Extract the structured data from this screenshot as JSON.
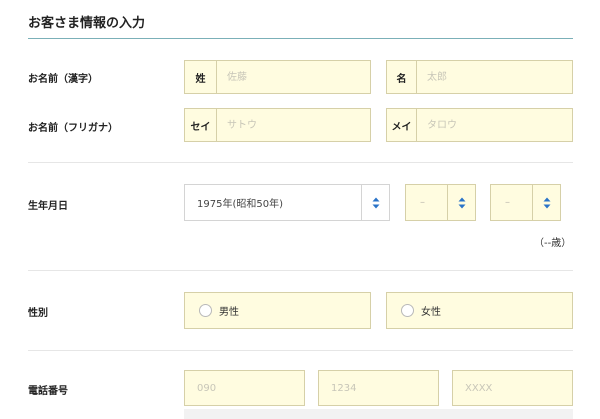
{
  "section": {
    "title": "お客さま情報の入力"
  },
  "name_kanji": {
    "label": "お名前（漢字）",
    "last": {
      "prefix": "姓",
      "placeholder": "佐藤",
      "value": ""
    },
    "first": {
      "prefix": "名",
      "placeholder": "太郎",
      "value": ""
    }
  },
  "name_kana": {
    "label": "お名前（フリガナ）",
    "last": {
      "prefix": "セイ",
      "placeholder": "サトウ",
      "value": ""
    },
    "first": {
      "prefix": "メイ",
      "placeholder": "タロウ",
      "value": ""
    }
  },
  "birthdate": {
    "label": "生年月日",
    "year": "1975年(昭和50年)",
    "month": "–",
    "day": "–",
    "age": "（--歳）"
  },
  "gender": {
    "label": "性別",
    "options": [
      "男性",
      "女性"
    ]
  },
  "phone": {
    "label": "電話番号",
    "placeholders": [
      "090",
      "1234",
      "XXXX"
    ]
  },
  "colors": {
    "input_bg": "#fffce0",
    "arrow_blue": "#2a73c8"
  },
  "icons": {
    "select_arrow": "up-down-arrow-icon"
  }
}
